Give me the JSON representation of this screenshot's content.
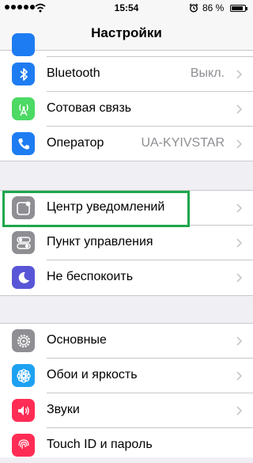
{
  "status": {
    "time": "15:54",
    "battery": "86 %"
  },
  "navbar": {
    "title": "Настройки"
  },
  "rows": {
    "bluetooth": {
      "label": "Bluetooth",
      "value": "Выкл."
    },
    "cellular": {
      "label": "Сотовая связь"
    },
    "carrier": {
      "label": "Оператор",
      "value": "UA-KYIVSTAR"
    },
    "notifications": {
      "label": "Центр уведомлений"
    },
    "control": {
      "label": "Пункт управления"
    },
    "dnd": {
      "label": "Не беспокоить"
    },
    "general": {
      "label": "Основные"
    },
    "wallpaper": {
      "label": "Обои и яркость"
    },
    "sounds": {
      "label": "Звуки"
    },
    "touchid": {
      "label": "Touch ID и пароль"
    }
  },
  "colors": {
    "bluetooth": "#1e7cf2",
    "cellular": "#4cd964",
    "carrier": "#1e7cf2",
    "notifications": "#8e8e93",
    "control": "#8e8e93",
    "dnd": "#5856d6",
    "general": "#8e8e93",
    "wallpaper": "#1ea1f2",
    "sounds": "#ff2d55",
    "touchid": "#ff2d55",
    "highlight": "#1ca74b"
  },
  "icons": {
    "bluetooth": "bluetooth-icon",
    "cellular": "antenna-icon",
    "carrier": "phone-icon",
    "notifications": "notification-center-icon",
    "control": "toggles-icon",
    "dnd": "moon-icon",
    "general": "gear-icon",
    "wallpaper": "flower-icon",
    "sounds": "speaker-icon",
    "touchid": "fingerprint-icon"
  }
}
